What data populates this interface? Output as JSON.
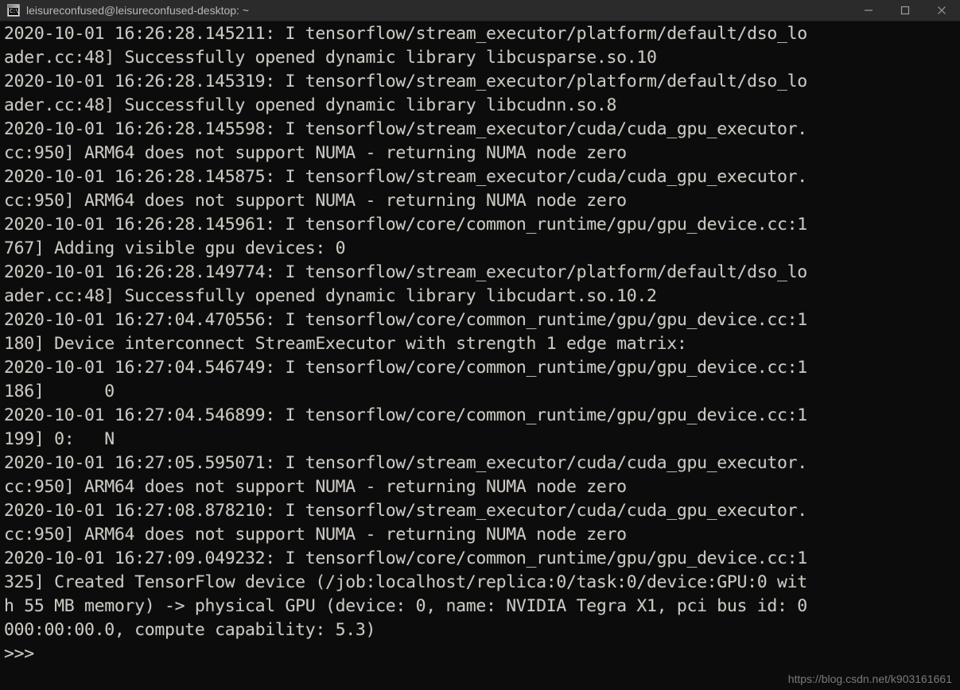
{
  "window": {
    "title": "leisureconfused@leisureconfused-desktop: ~",
    "icon": "console-window-icon",
    "icon_glyph": "C:\\_",
    "background_color": "#0c0c0c",
    "titlebar_color": "#2b2b2b",
    "text_color": "#ccc9c2"
  },
  "controls": {
    "minimize": "minimize-icon",
    "maximize": "maximize-icon",
    "close": "close-icon"
  },
  "terminal": {
    "prompt": ">>>",
    "lines": [
      "2020-10-01 16:26:28.145211: I tensorflow/stream_executor/platform/default/dso_lo",
      "ader.cc:48] Successfully opened dynamic library libcusparse.so.10",
      "2020-10-01 16:26:28.145319: I tensorflow/stream_executor/platform/default/dso_lo",
      "ader.cc:48] Successfully opened dynamic library libcudnn.so.8",
      "2020-10-01 16:26:28.145598: I tensorflow/stream_executor/cuda/cuda_gpu_executor.",
      "cc:950] ARM64 does not support NUMA - returning NUMA node zero",
      "2020-10-01 16:26:28.145875: I tensorflow/stream_executor/cuda/cuda_gpu_executor.",
      "cc:950] ARM64 does not support NUMA - returning NUMA node zero",
      "2020-10-01 16:26:28.145961: I tensorflow/core/common_runtime/gpu/gpu_device.cc:1",
      "767] Adding visible gpu devices: 0",
      "2020-10-01 16:26:28.149774: I tensorflow/stream_executor/platform/default/dso_lo",
      "ader.cc:48] Successfully opened dynamic library libcudart.so.10.2",
      "2020-10-01 16:27:04.470556: I tensorflow/core/common_runtime/gpu/gpu_device.cc:1",
      "180] Device interconnect StreamExecutor with strength 1 edge matrix:",
      "2020-10-01 16:27:04.546749: I tensorflow/core/common_runtime/gpu/gpu_device.cc:1",
      "186]      0",
      "2020-10-01 16:27:04.546899: I tensorflow/core/common_runtime/gpu/gpu_device.cc:1",
      "199] 0:   N",
      "2020-10-01 16:27:05.595071: I tensorflow/stream_executor/cuda/cuda_gpu_executor.",
      "cc:950] ARM64 does not support NUMA - returning NUMA node zero",
      "2020-10-01 16:27:08.878210: I tensorflow/stream_executor/cuda/cuda_gpu_executor.",
      "cc:950] ARM64 does not support NUMA - returning NUMA node zero",
      "2020-10-01 16:27:09.049232: I tensorflow/core/common_runtime/gpu/gpu_device.cc:1",
      "325] Created TensorFlow device (/job:localhost/replica:0/task:0/device:GPU:0 wit",
      "h 55 MB memory) -> physical GPU (device: 0, name: NVIDIA Tegra X1, pci bus id: 0",
      "000:00:00.0, compute capability: 5.3)",
      ">>>"
    ]
  },
  "watermark": {
    "text": "https://blog.csdn.net/k903161661"
  }
}
